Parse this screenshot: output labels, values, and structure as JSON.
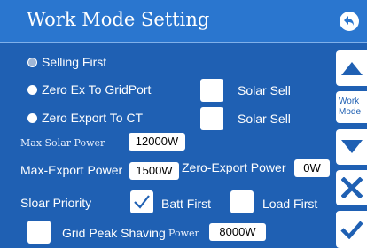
{
  "header": {
    "title": "Work Mode Setting",
    "back_icon": "back-arrow-icon"
  },
  "modes": {
    "selling_first": {
      "label": "Selling First",
      "selected": false
    },
    "zero_ex_to_gridport": {
      "label": "Zero Ex To GridPort",
      "selected": true,
      "solar_sell_label": "Solar Sell",
      "solar_sell_checked": false
    },
    "zero_export_to_ct": {
      "label": "Zero Export To CT",
      "selected": true,
      "solar_sell_label": "Solar Sell",
      "solar_sell_checked": false
    }
  },
  "max_solar_power": {
    "label": "Max Solar Power",
    "value": "12000W"
  },
  "max_export_power": {
    "label": "Max-Export Power",
    "value": "1500W"
  },
  "zero_export_power": {
    "label": "Zero-Export Power",
    "value": "0W"
  },
  "solar_priority": {
    "label": "Sloar Priority",
    "batt_first_label": "Batt First",
    "batt_first_checked": true,
    "load_first_label": "Load First",
    "load_first_checked": false
  },
  "grid_peak_shaving": {
    "label": "Grid Peak Shaving",
    "power_label": "Power",
    "value": "8000W",
    "checked": false
  },
  "side_panel": {
    "page_label_line1": "Work",
    "page_label_line2": "Mode",
    "buttons": [
      "up-arrow-icon",
      "down-arrow-icon",
      "cancel-icon",
      "confirm-icon"
    ]
  },
  "colors": {
    "background": "#1f60b3",
    "title_bar": "#2a76cf",
    "text": "#ffffff"
  }
}
